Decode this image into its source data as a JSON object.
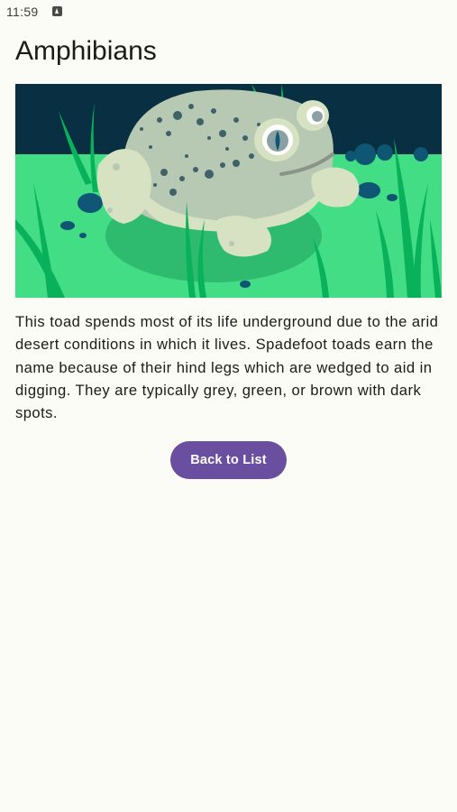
{
  "status_bar": {
    "time": "11:59",
    "notification_icon": "app-notification-icon"
  },
  "page": {
    "title": "Amphibians"
  },
  "hero_image": {
    "subject": "spadefoot-toad-illustration",
    "colors": {
      "sky": "#082f42",
      "grass": "#42dd85",
      "toad": "#b7c9b3",
      "leaf": "#09b15a"
    }
  },
  "description": "This toad spends most of its life underground due to the arid desert conditions in which it lives. Spadefoot toads earn the name because of their hind legs which are wedged to aid in digging. They are typically grey, green, or brown with dark spots.",
  "actions": {
    "back_label": "Back to List",
    "accent_color": "#6a4fa0"
  }
}
